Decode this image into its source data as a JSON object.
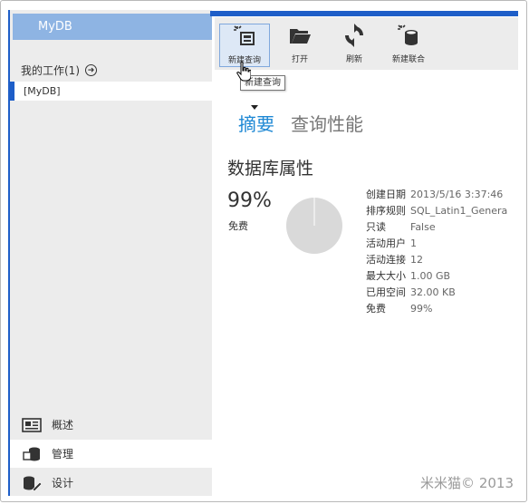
{
  "sidebar": {
    "db_name": "MyDB",
    "work_title": "我的工作(1)",
    "db_item": "[MyDB]",
    "nav": [
      {
        "label": "概述",
        "icon": "overview-icon"
      },
      {
        "label": "管理",
        "icon": "manage-icon"
      },
      {
        "label": "设计",
        "icon": "design-icon"
      }
    ]
  },
  "toolbar": {
    "new_query": "新建查询",
    "open": "打开",
    "refresh": "刷新",
    "new_union": "新建联合",
    "tooltip": "新建查询"
  },
  "tabs": {
    "summary": "摘要",
    "query_perf": "查询性能"
  },
  "summary": {
    "section_title": "数据库属性",
    "free_pct": "99%",
    "free_label": "免费",
    "pie_free_fraction": 0.99,
    "props": [
      {
        "k": "创建日期",
        "v": "2013/5/16 3:37:46"
      },
      {
        "k": "排序规则",
        "v": "SQL_Latin1_Genera"
      },
      {
        "k": "只读",
        "v": "False"
      },
      {
        "k": "活动用户",
        "v": "1"
      },
      {
        "k": "活动连接",
        "v": "12"
      },
      {
        "k": "最大大小",
        "v": "1.00 GB"
      },
      {
        "k": "已用空间",
        "v": "32.00 KB"
      },
      {
        "k": "免费",
        "v": "99%"
      }
    ]
  },
  "footer": {
    "copyright": "米米猫© 2013"
  },
  "colors": {
    "accent": "#1e5ec8",
    "tab_active": "#1e88d4",
    "header": "#8eb4e3"
  }
}
